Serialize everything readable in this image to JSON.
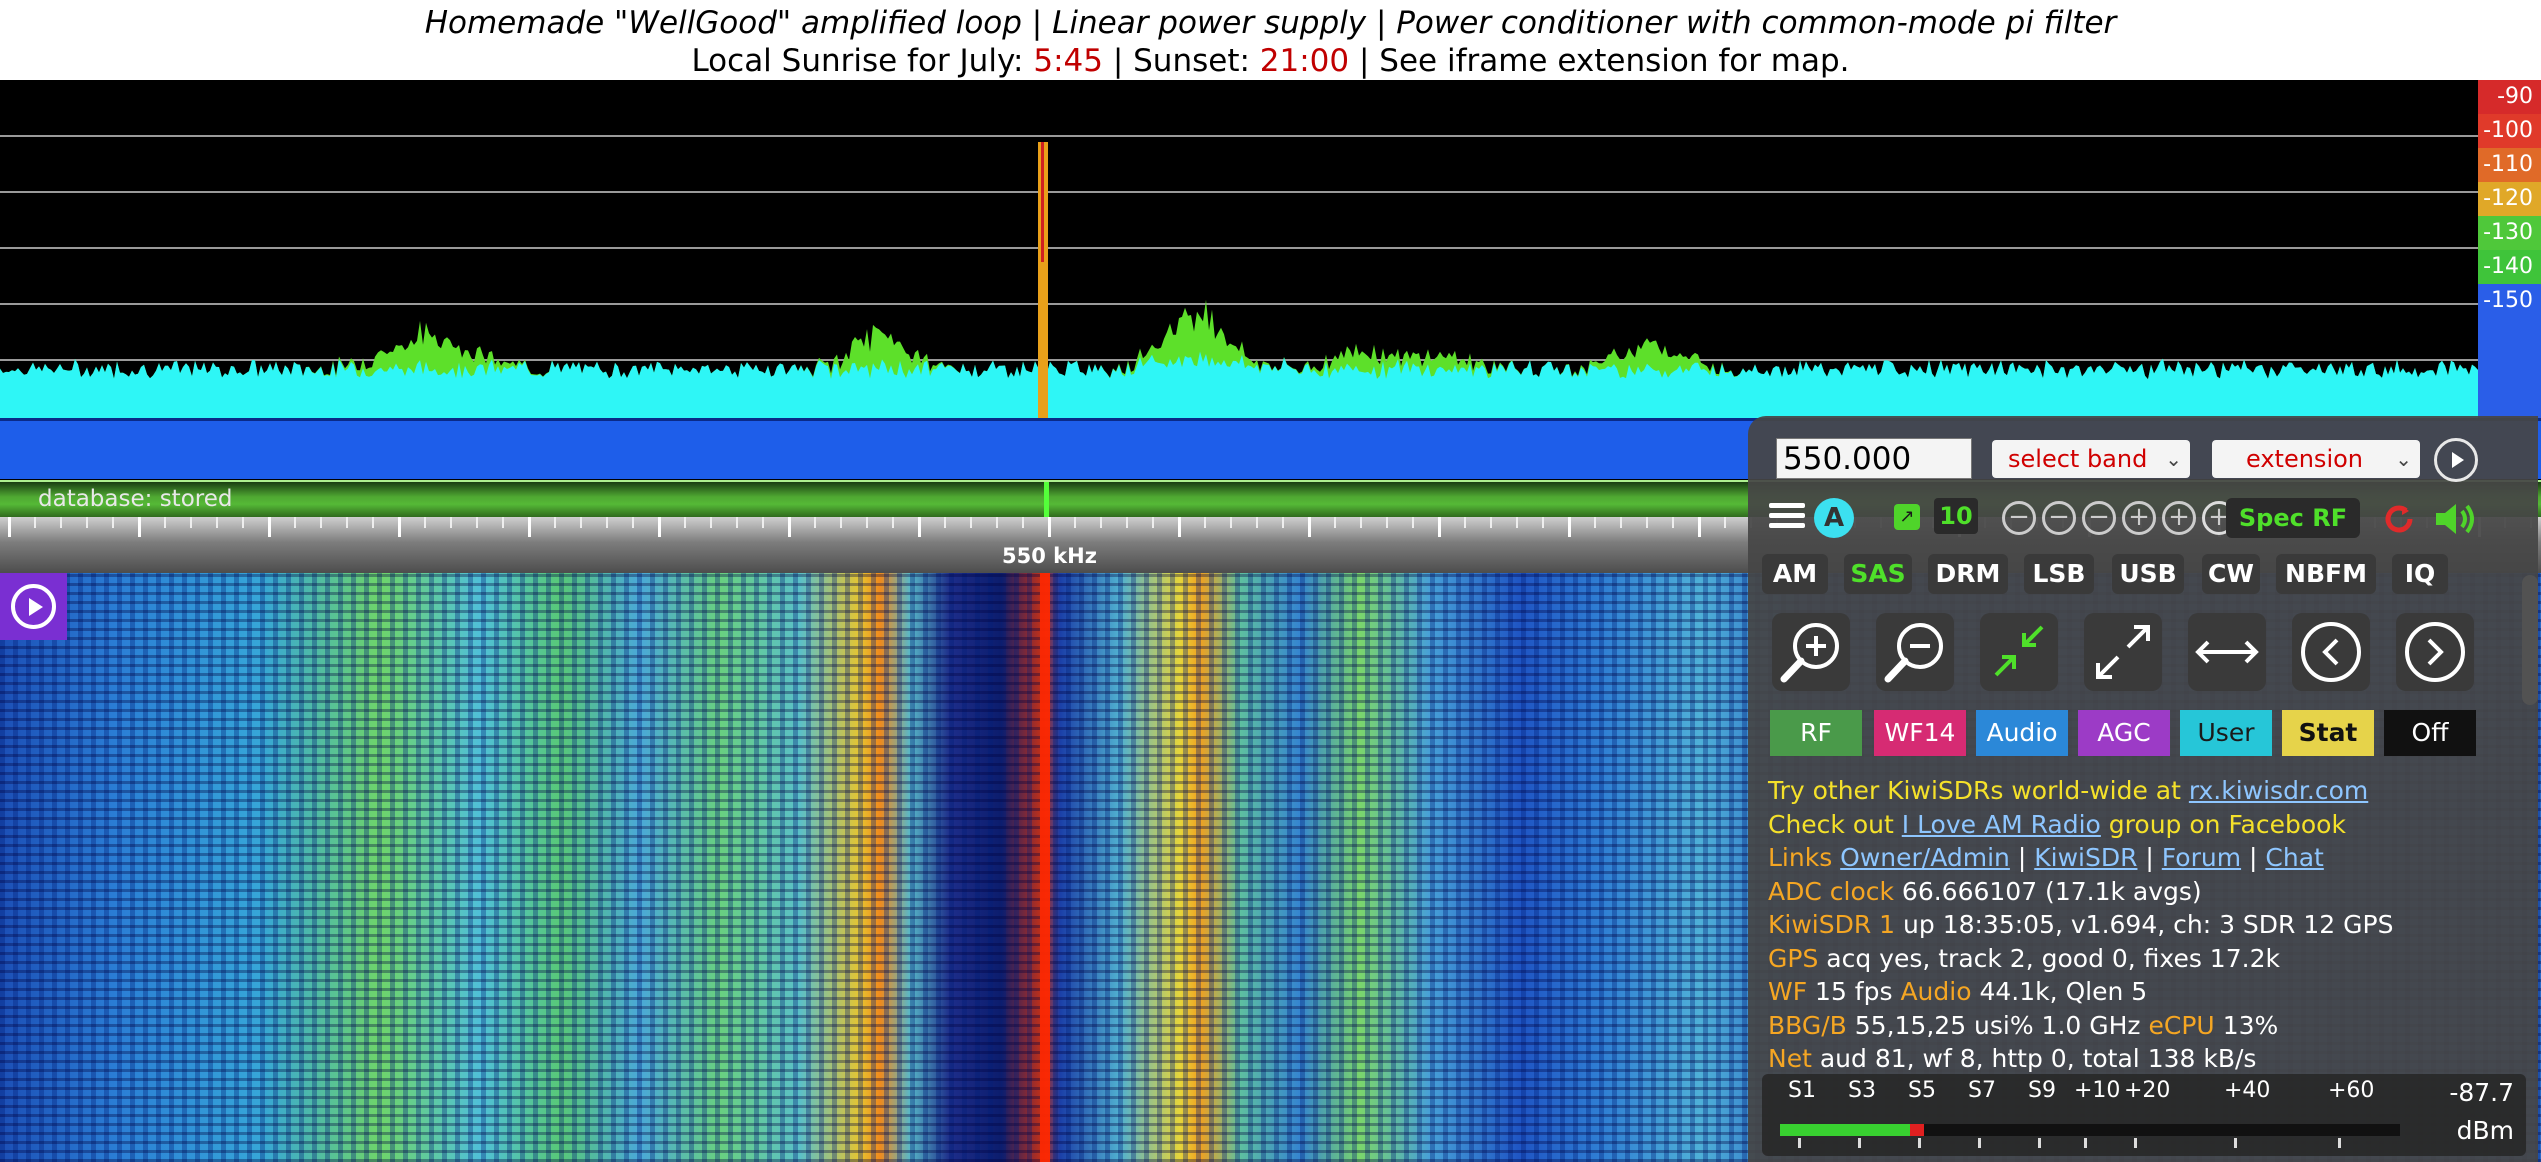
{
  "banner": {
    "line1": "Homemade \"WellGood\" amplified loop | Linear power supply | Power conditioner with common-mode pi filter",
    "sunrise_prefix": "Local Sunrise for July: ",
    "sunrise_time": "5:45",
    "sunset_prefix": " | Sunset: ",
    "sunset_time": "21:00",
    "line2_suffix": " | See iframe extension for map."
  },
  "spectrum": {
    "db_scale": [
      "-90",
      "-100",
      "-110",
      "-120",
      "-130",
      "-140",
      "-150"
    ],
    "db_scale_colors": [
      "#d62a2a",
      "#e03a2a",
      "#e06a28",
      "#e0a828",
      "#4fc83a",
      "#3fc43a",
      "#2a5ee8"
    ],
    "trace_color_base": "#2ef6f6",
    "trace_color_peaks": "#5de02a",
    "carrier_color": "#e8a01a"
  },
  "band_bar": {
    "database_status": "database: stored"
  },
  "ruler": {
    "center_freq_label": "550 kHz"
  },
  "controls": {
    "frequency_value": "550.000",
    "band_select": "select band",
    "extension_select": "extension",
    "auto_label": "A",
    "step_label": "10",
    "spec_rf_label": "Spec RF",
    "modes": [
      "AM",
      "SAS",
      "DRM",
      "LSB",
      "USB",
      "CW",
      "NBFM",
      "IQ"
    ],
    "active_mode": "SAS",
    "tabs": [
      {
        "label": "RF",
        "bg": "#4a9a4a",
        "color": "#ffffff"
      },
      {
        "label": "WF14",
        "bg": "#d62b73",
        "color": "#ffffff"
      },
      {
        "label": "Audio",
        "bg": "#2b88d8",
        "color": "#ffffff"
      },
      {
        "label": "AGC",
        "bg": "#9c3bc6",
        "color": "#ffffff"
      },
      {
        "label": "User",
        "bg": "#26c6d8",
        "color": "#1a1a1a"
      },
      {
        "label": "Stat",
        "bg": "#e6d34a",
        "color": "#111111"
      },
      {
        "label": "Off",
        "bg": "#111111",
        "color": "#ffffff"
      }
    ]
  },
  "info": {
    "try_text": "Try other KiwiSDRs world-wide at ",
    "try_link": "rx.kiwisdr.com",
    "checkout_prefix": "Check out ",
    "checkout_link": "I Love AM Radio",
    "checkout_suffix": " group on Facebook",
    "links_label": "Links ",
    "links": [
      "Owner/Admin",
      "KiwiSDR",
      "Forum",
      "Chat"
    ],
    "adc_label": "ADC clock ",
    "adc_value": "66.666107 (17.1k avgs)",
    "kiwi_label": "KiwiSDR 1 ",
    "kiwi_value": "up 18:35:05, v1.694, ch: 3 SDR 12 GPS",
    "gps_label": "GPS ",
    "gps_value": "acq yes, track 2, good 0, fixes 17.2k",
    "wf_label": "WF ",
    "wf_value": "15 fps ",
    "audio_label": "Audio ",
    "audio_value": "44.1k, Qlen 5",
    "bbg_label": "BBG/B ",
    "bbg_value": "55,15,25 usi% 1.0 GHz ",
    "ecpu_label": "eCPU ",
    "ecpu_value": "13%",
    "net_label": "Net ",
    "net_value": "aud 81, wf 8, http 0, total 138 kB/s"
  },
  "smeter": {
    "labels": [
      "S1",
      "S3",
      "S5",
      "S7",
      "S9",
      "+10",
      "+20",
      "+40",
      "+60"
    ],
    "value": "-87.7",
    "unit": "dBm",
    "level_fraction": 0.21
  }
}
